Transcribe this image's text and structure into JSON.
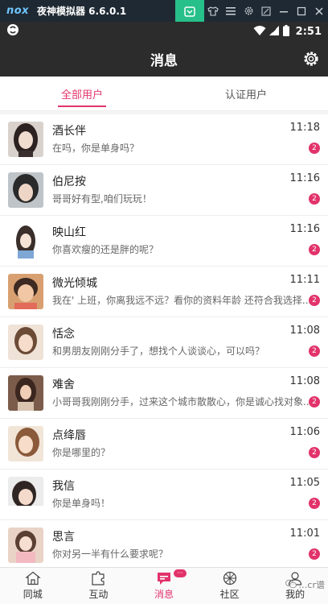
{
  "emulator": {
    "logo": "nox",
    "title": "夜神模拟器 6.6.0.1",
    "buttons": [
      "app-center-icon",
      "shirt-icon",
      "menu-icon",
      "gear-icon",
      "collapse-icon",
      "minimize-icon",
      "maximize-icon",
      "close-icon"
    ]
  },
  "status_bar": {
    "time": "2:51"
  },
  "header": {
    "title": "消息"
  },
  "tabs": [
    {
      "label": "全部用户",
      "active": true
    },
    {
      "label": "认证用户",
      "active": false
    }
  ],
  "messages": [
    {
      "name": "酒长伴",
      "preview": "在吗，你是单身吗？",
      "time": "11:18",
      "unread": "2"
    },
    {
      "name": "伯尼按",
      "preview": "哥哥好有型,咱们玩玩！",
      "time": "11:16",
      "unread": "2"
    },
    {
      "name": "映山红",
      "preview": "你喜欢瘦的还是胖的呢？",
      "time": "11:16",
      "unread": "2"
    },
    {
      "name": "微光倾城",
      "preview": "我在' 上班，你离我远不远？看你的资料年龄 还符合我选择...",
      "time": "11:11",
      "unread": "2"
    },
    {
      "name": "恬念",
      "preview": "和男朋友刚刚分手了，想找个人谈谈心，可以吗？",
      "time": "11:08",
      "unread": "2"
    },
    {
      "name": "难舍",
      "preview": "小哥哥我刚刚分手，过来这个城市散散心，你是诚心找对象...",
      "time": "11:08",
      "unread": "2"
    },
    {
      "name": "点绛唇",
      "preview": "你是哪里的？",
      "time": "11:06",
      "unread": "2"
    },
    {
      "name": "我信",
      "preview": "你是单身吗！",
      "time": "11:05",
      "unread": "2"
    },
    {
      "name": "思言",
      "preview": "你对另一半有什么要求呢？",
      "time": "11:01",
      "unread": "2"
    }
  ],
  "nav": [
    {
      "label": "同城",
      "icon": "home-icon",
      "active": false
    },
    {
      "label": "互动",
      "icon": "puzzle-icon",
      "active": false
    },
    {
      "label": "消息",
      "icon": "message-icon",
      "active": true,
      "badge": "···"
    },
    {
      "label": "社区",
      "icon": "community-icon",
      "active": false
    },
    {
      "label": "我的",
      "icon": "profile-icon",
      "active": false
    }
  ],
  "watermark": "…cr谱",
  "colors": {
    "accent": "#e2336b",
    "header_bg": "#2c2c2c",
    "emulator_bar": "#1f2933",
    "emulator_active": "#27c08a"
  }
}
